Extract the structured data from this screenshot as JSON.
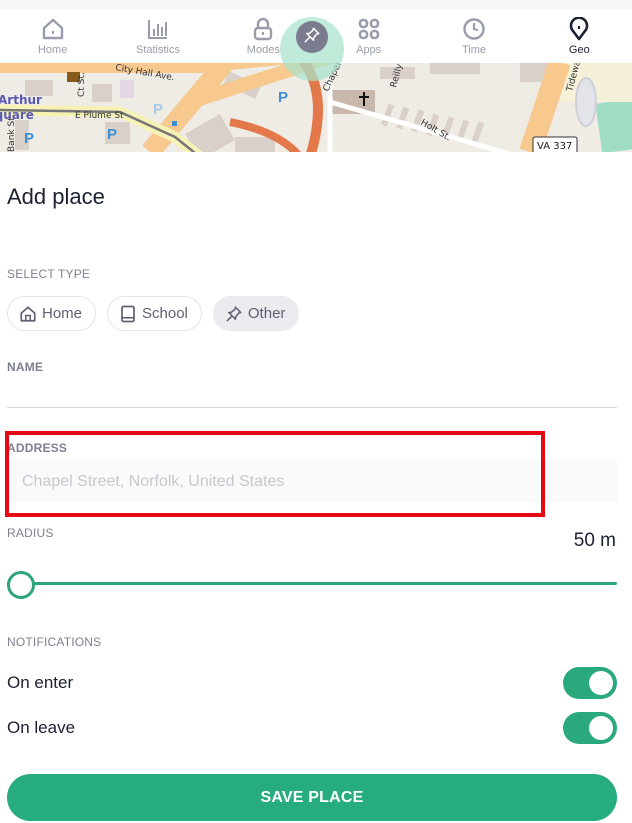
{
  "nav": {
    "items": [
      {
        "label": "Home",
        "icon": "home-icon",
        "active": false
      },
      {
        "label": "Statistics",
        "icon": "bar-chart-icon",
        "active": false
      },
      {
        "label": "Modes",
        "icon": "lock-icon",
        "active": false
      },
      {
        "label": "Apps",
        "icon": "apps-grid-icon",
        "active": false
      },
      {
        "label": "Time",
        "icon": "clock-icon",
        "active": false
      },
      {
        "label": "Geo",
        "icon": "map-pin-icon",
        "active": true
      }
    ],
    "fab_icon": "pushpin-icon"
  },
  "map": {
    "labels": {
      "city_hall": "City Hall Ave.",
      "plume": "E Plume St",
      "arthur": "Arthur",
      "square": "Square",
      "bank": "Bank St.",
      "court": "Ct St.",
      "chapel": "Chapel",
      "reilly": "Reilly St.",
      "holt": "Holt St.",
      "tidewater": "Tidewater",
      "route_shield": "VA 337",
      "parking": "P"
    }
  },
  "page": {
    "title": "Add place"
  },
  "select_type": {
    "label": "SELECT TYPE",
    "options": [
      {
        "label": "Home",
        "icon": "home-icon",
        "selected": false
      },
      {
        "label": "School",
        "icon": "book-icon",
        "selected": false
      },
      {
        "label": "Other",
        "icon": "pushpin-icon",
        "selected": true
      }
    ]
  },
  "name": {
    "label": "NAME",
    "value": ""
  },
  "address": {
    "label": "ADDRESS",
    "placeholder": "Chapel Street, Norfolk, United States",
    "value": ""
  },
  "radius": {
    "label": "RADIUS",
    "value_text": "50 m",
    "value": 50,
    "slider_fraction": 0.0
  },
  "notifications": {
    "label": "NOTIFICATIONS",
    "on_enter": {
      "label": "On enter",
      "enabled": true
    },
    "on_leave": {
      "label": "On leave",
      "enabled": true
    }
  },
  "save_button": {
    "label": "SAVE PLACE"
  },
  "colors": {
    "accent": "#2aaa7c",
    "highlight": "#e50914",
    "muted_text": "#7f8191"
  }
}
